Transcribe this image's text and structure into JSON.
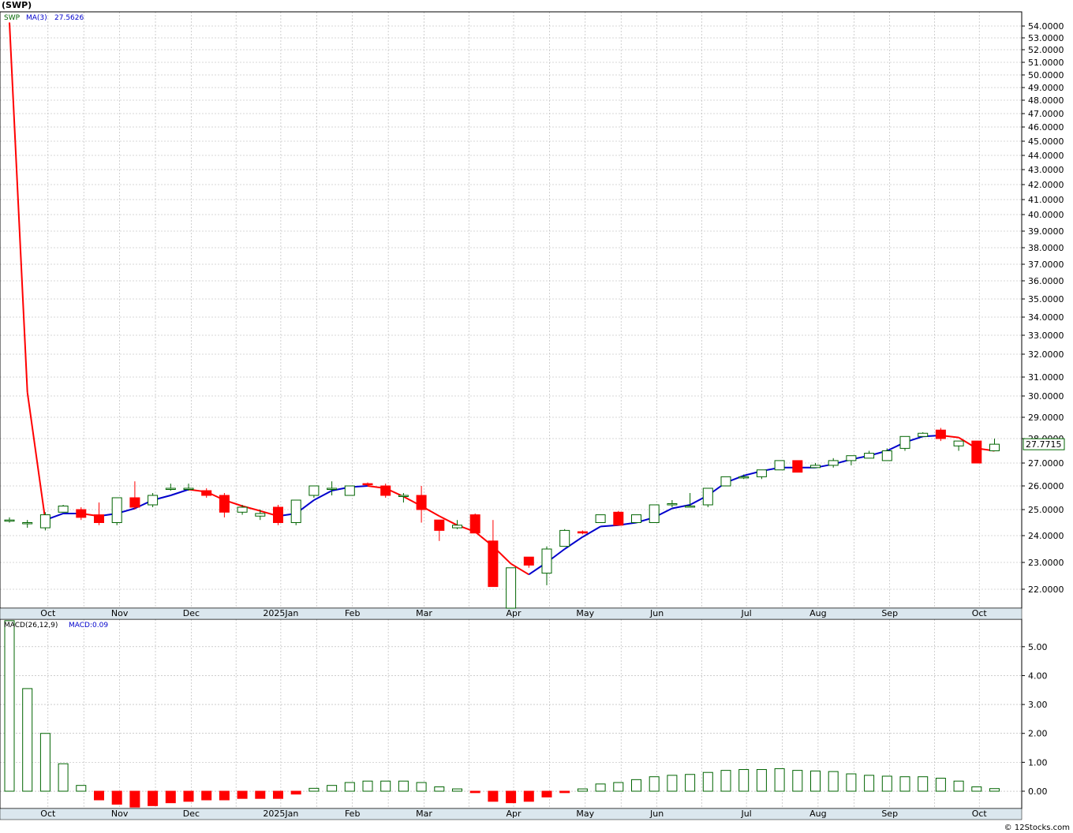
{
  "header": {
    "title": "(SWP)"
  },
  "legend": {
    "symbol": "SWP",
    "ma_label": "MA(3)",
    "ma_value": "27.5626",
    "macd_label": "MACD(26,12,9)",
    "macd_value": "MACD:0.09"
  },
  "last_price_label": "27.7715",
  "credit": "© 12Stocks.com",
  "colors": {
    "up": "#006400",
    "down": "#ff0000",
    "ma_up": "#0000cc",
    "ma_down": "#ff0000",
    "grid": "#b0b0b0",
    "band": "#dbe7ee"
  },
  "chart_data": [
    {
      "type": "candlestick",
      "title": "(SWP)",
      "ylim": [
        21.2,
        55.2
      ],
      "y_ticks": [
        "22.0000",
        "23.0000",
        "24.0000",
        "25.0000",
        "26.0000",
        "27.0000",
        "28.0000",
        "29.0000",
        "30.0000",
        "31.0000",
        "32.0000",
        "33.0000",
        "34.0000",
        "35.0000",
        "36.0000",
        "37.0000",
        "38.0000",
        "39.0000",
        "40.0000",
        "41.0000",
        "42.0000",
        "43.0000",
        "44.0000",
        "45.0000",
        "46.0000",
        "47.0000",
        "48.0000",
        "49.0000",
        "50.0000",
        "51.0000",
        "52.0000",
        "53.0000",
        "54.0000"
      ],
      "x_labels": [
        {
          "label": "Oct",
          "index": 2
        },
        {
          "label": "Nov",
          "index": 6
        },
        {
          "label": "Dec",
          "index": 10
        },
        {
          "label": "2025Jan",
          "index": 15
        },
        {
          "label": "Feb",
          "index": 19
        },
        {
          "label": "Mar",
          "index": 23
        },
        {
          "label": "Apr",
          "index": 28
        },
        {
          "label": "May",
          "index": 32
        },
        {
          "label": "Jun",
          "index": 36
        },
        {
          "label": "Jul",
          "index": 41
        },
        {
          "label": "Aug",
          "index": 45
        },
        {
          "label": "Sep",
          "index": 49
        },
        {
          "label": "Oct",
          "index": 54
        }
      ],
      "candles": [
        {
          "o": 24.6,
          "h": 24.7,
          "l": 24.5,
          "c": 24.6
        },
        {
          "o": 24.5,
          "h": 24.6,
          "l": 24.3,
          "c": 24.5
        },
        {
          "o": 24.3,
          "h": 24.9,
          "l": 24.2,
          "c": 24.8
        },
        {
          "o": 24.9,
          "h": 25.2,
          "l": 24.9,
          "c": 25.15
        },
        {
          "o": 25.0,
          "h": 25.1,
          "l": 24.6,
          "c": 24.7
        },
        {
          "o": 24.8,
          "h": 25.3,
          "l": 24.4,
          "c": 24.5
        },
        {
          "o": 24.5,
          "h": 25.5,
          "l": 24.4,
          "c": 25.5
        },
        {
          "o": 25.5,
          "h": 26.2,
          "l": 25.0,
          "c": 25.1
        },
        {
          "o": 25.2,
          "h": 25.7,
          "l": 25.1,
          "c": 25.6
        },
        {
          "o": 25.9,
          "h": 26.1,
          "l": 25.8,
          "c": 25.9
        },
        {
          "o": 25.9,
          "h": 26.1,
          "l": 25.8,
          "c": 25.9
        },
        {
          "o": 25.8,
          "h": 25.9,
          "l": 25.5,
          "c": 25.6
        },
        {
          "o": 25.6,
          "h": 25.7,
          "l": 24.7,
          "c": 24.9
        },
        {
          "o": 24.9,
          "h": 25.2,
          "l": 24.8,
          "c": 25.1
        },
        {
          "o": 24.75,
          "h": 25.0,
          "l": 24.6,
          "c": 24.85
        },
        {
          "o": 25.1,
          "h": 25.2,
          "l": 24.4,
          "c": 24.5
        },
        {
          "o": 24.5,
          "h": 25.4,
          "l": 24.4,
          "c": 25.4
        },
        {
          "o": 25.6,
          "h": 26.0,
          "l": 25.5,
          "c": 26.0
        },
        {
          "o": 25.9,
          "h": 26.2,
          "l": 25.6,
          "c": 25.9
        },
        {
          "o": 25.6,
          "h": 26.0,
          "l": 25.6,
          "c": 26.0
        },
        {
          "o": 26.1,
          "h": 26.15,
          "l": 26.0,
          "c": 26.05
        },
        {
          "o": 26.0,
          "h": 26.1,
          "l": 25.5,
          "c": 25.6
        },
        {
          "o": 25.6,
          "h": 25.7,
          "l": 25.3,
          "c": 25.6
        },
        {
          "o": 25.6,
          "h": 26.0,
          "l": 24.5,
          "c": 25.0
        },
        {
          "o": 24.6,
          "h": 24.6,
          "l": 23.8,
          "c": 24.2
        },
        {
          "o": 24.3,
          "h": 24.6,
          "l": 24.25,
          "c": 24.4
        },
        {
          "o": 24.8,
          "h": 24.85,
          "l": 24.1,
          "c": 24.1
        },
        {
          "o": 23.8,
          "h": 24.6,
          "l": 22.1,
          "c": 22.1
        },
        {
          "o": 21.2,
          "h": 22.8,
          "l": 21.2,
          "c": 22.8
        },
        {
          "o": 23.2,
          "h": 23.2,
          "l": 22.8,
          "c": 22.9
        },
        {
          "o": 22.6,
          "h": 23.6,
          "l": 22.15,
          "c": 23.5
        },
        {
          "o": 23.6,
          "h": 24.25,
          "l": 23.6,
          "c": 24.2
        },
        {
          "o": 24.15,
          "h": 24.2,
          "l": 24.05,
          "c": 24.1
        },
        {
          "o": 24.5,
          "h": 24.8,
          "l": 24.5,
          "c": 24.8
        },
        {
          "o": 24.9,
          "h": 24.95,
          "l": 24.4,
          "c": 24.4
        },
        {
          "o": 24.5,
          "h": 24.8,
          "l": 24.5,
          "c": 24.8
        },
        {
          "o": 24.5,
          "h": 25.2,
          "l": 24.5,
          "c": 25.2
        },
        {
          "o": 25.2,
          "h": 25.4,
          "l": 25.1,
          "c": 25.25
        },
        {
          "o": 25.1,
          "h": 25.7,
          "l": 25.1,
          "c": 25.15
        },
        {
          "o": 25.2,
          "h": 25.9,
          "l": 25.1,
          "c": 25.9
        },
        {
          "o": 26.0,
          "h": 26.4,
          "l": 26.0,
          "c": 26.4
        },
        {
          "o": 26.4,
          "h": 26.5,
          "l": 26.3,
          "c": 26.4
        },
        {
          "o": 26.4,
          "h": 26.7,
          "l": 26.3,
          "c": 26.7
        },
        {
          "o": 26.7,
          "h": 27.1,
          "l": 26.7,
          "c": 27.1
        },
        {
          "o": 27.1,
          "h": 27.1,
          "l": 26.6,
          "c": 26.6
        },
        {
          "o": 26.8,
          "h": 27.0,
          "l": 26.8,
          "c": 26.9
        },
        {
          "o": 26.9,
          "h": 27.2,
          "l": 26.8,
          "c": 27.1
        },
        {
          "o": 27.1,
          "h": 27.3,
          "l": 26.9,
          "c": 27.3
        },
        {
          "o": 27.2,
          "h": 27.5,
          "l": 27.2,
          "c": 27.4
        },
        {
          "o": 27.1,
          "h": 27.6,
          "l": 27.1,
          "c": 27.5
        },
        {
          "o": 27.6,
          "h": 28.1,
          "l": 27.5,
          "c": 28.1
        },
        {
          "o": 28.1,
          "h": 28.3,
          "l": 28.1,
          "c": 28.25
        },
        {
          "o": 28.4,
          "h": 28.5,
          "l": 27.9,
          "c": 28.0
        },
        {
          "o": 27.7,
          "h": 27.9,
          "l": 27.5,
          "c": 27.9
        },
        {
          "o": 27.9,
          "h": 27.9,
          "l": 27.0,
          "c": 27.0
        },
        {
          "o": 27.5,
          "h": 28.0,
          "l": 27.5,
          "c": 27.77
        }
      ],
      "ma": [
        54.3,
        30.2,
        24.6,
        24.85,
        24.85,
        24.75,
        24.85,
        25.05,
        25.4,
        25.6,
        25.85,
        25.75,
        25.4,
        25.15,
        24.95,
        24.75,
        24.85,
        25.4,
        25.8,
        25.95,
        26.0,
        25.9,
        25.55,
        25.15,
        24.75,
        24.4,
        24.15,
        23.6,
        22.95,
        22.55,
        23.0,
        23.5,
        23.95,
        24.35,
        24.4,
        24.5,
        24.7,
        25.05,
        25.2,
        25.6,
        26.15,
        26.45,
        26.65,
        26.8,
        26.8,
        26.8,
        26.95,
        27.15,
        27.3,
        27.5,
        27.85,
        28.1,
        28.15,
        28.05,
        27.6,
        27.5
      ],
      "series": [
        {
          "name": "SWP"
        },
        {
          "name": "MA(3)"
        }
      ]
    },
    {
      "type": "bar",
      "title": "MACD(26,12,9)",
      "ylim": [
        -0.6,
        5.95
      ],
      "y_ticks": [
        "0.00",
        "1.00",
        "2.00",
        "3.00",
        "4.00",
        "5.00"
      ],
      "values": [
        5.9,
        3.55,
        2.0,
        0.95,
        0.2,
        -0.3,
        -0.45,
        -0.55,
        -0.5,
        -0.4,
        -0.35,
        -0.3,
        -0.3,
        -0.25,
        -0.25,
        -0.25,
        -0.1,
        0.1,
        0.2,
        0.3,
        0.35,
        0.35,
        0.35,
        0.3,
        0.15,
        0.08,
        -0.05,
        -0.35,
        -0.4,
        -0.35,
        -0.2,
        -0.05,
        0.08,
        0.25,
        0.3,
        0.4,
        0.5,
        0.55,
        0.58,
        0.65,
        0.72,
        0.75,
        0.75,
        0.78,
        0.72,
        0.7,
        0.68,
        0.6,
        0.55,
        0.52,
        0.5,
        0.5,
        0.45,
        0.35,
        0.15,
        0.09
      ],
      "up_color": "#006400",
      "down_color": "#ff0000"
    }
  ]
}
